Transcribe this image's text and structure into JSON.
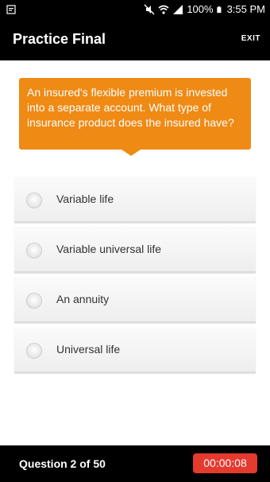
{
  "status_bar": {
    "battery_percent": "100%",
    "time": "3:55 PM",
    "icons": [
      "notification-icon",
      "mute-icon",
      "wifi-icon",
      "signal-icon",
      "battery-icon"
    ]
  },
  "app_bar": {
    "title": "Practice Final",
    "exit_label": "EXIT"
  },
  "question": {
    "text": "An insured's flexible premium is invested into a separate account. What type of insurance product does the insured have?"
  },
  "answers": [
    {
      "label": "Variable life"
    },
    {
      "label": "Variable universal life"
    },
    {
      "label": "An annuity"
    },
    {
      "label": "Universal life"
    }
  ],
  "footer": {
    "question_count": "Question 2 of 50",
    "timer": "00:00:08"
  },
  "colors": {
    "accent_orange": "#ef8a15",
    "timer_red": "#e53a2e",
    "bar_black": "#000000"
  }
}
